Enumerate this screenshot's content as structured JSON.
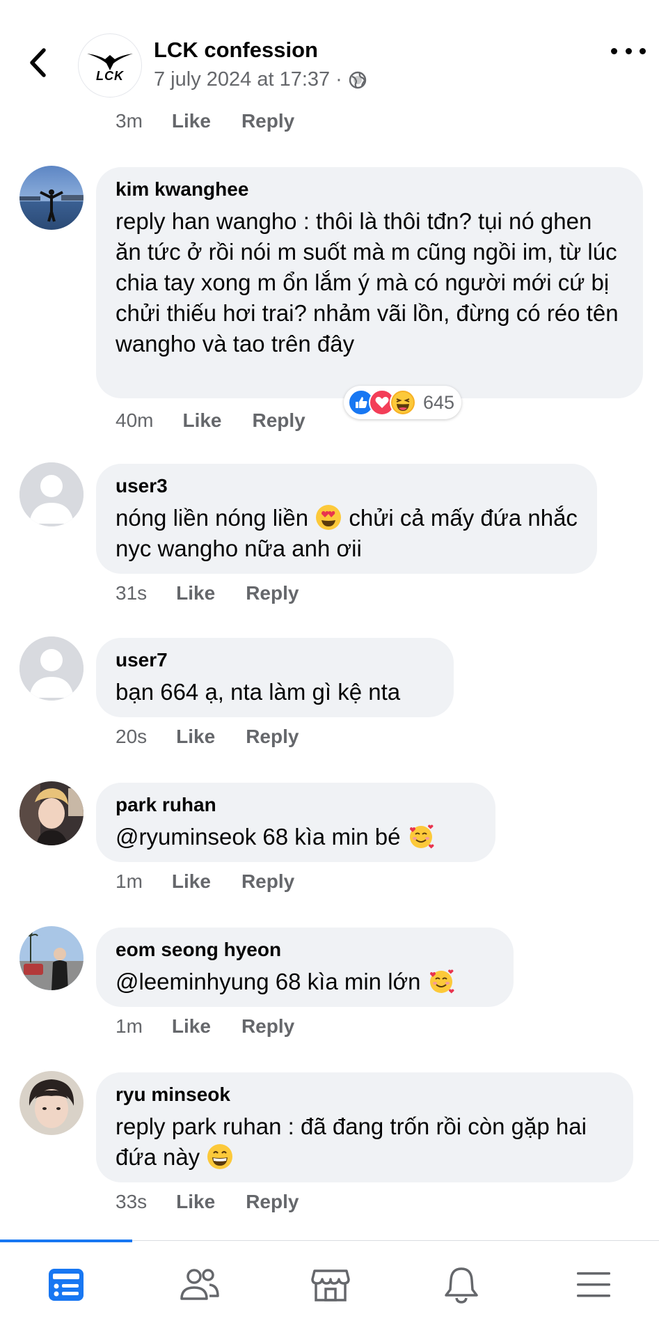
{
  "header": {
    "page_name": "LCK confession",
    "post_time": "7 july 2024 at 17:37",
    "separator": "·",
    "logo_text": "LCK"
  },
  "top_actions": {
    "time": "3m",
    "like": "Like",
    "reply": "Reply"
  },
  "comments": [
    {
      "author": "kim kwanghee",
      "text": "reply han wangho : thôi là thôi tđn? tụi nó ghen ăn tức ở rồi nói m suốt mà m cũng ngồi im, từ lúc chia tay xong m ổn lắm ý mà có người mới cứ bị chửi thiếu hơi trai? nhảm vãi lồn, đừng có réo tên wangho và tao trên đây",
      "time": "40m",
      "like": "Like",
      "reply": "Reply",
      "reaction_count": "645"
    },
    {
      "author": "user3",
      "text_before_emoji": "nóng liền nóng liền ",
      "text_after_emoji": " chửi cả mấy đứa nhắc nyc wangho nữa anh ơii",
      "emoji": "heart-eyes-emoji",
      "time": "31s",
      "like": "Like",
      "reply": "Reply"
    },
    {
      "author": "user7",
      "text": "bạn 664 ạ, nta làm gì kệ nta",
      "time": "20s",
      "like": "Like",
      "reply": "Reply"
    },
    {
      "author": "park ruhan",
      "text": "@ryuminseok 68 kìa min bé ",
      "emoji": "smiling-face-with-hearts-emoji",
      "time": "1m",
      "like": "Like",
      "reply": "Reply"
    },
    {
      "author": "eom seong hyeon",
      "text": "@leeminhyung 68 kìa min lớn ",
      "emoji": "smiling-face-with-hearts-emoji",
      "time": "1m",
      "like": "Like",
      "reply": "Reply"
    },
    {
      "author": "ryu minseok",
      "text": "reply park ruhan : đã đang trốn rồi còn gặp hai đứa này ",
      "emoji": "grinning-face-emoji",
      "time": "33s",
      "like": "Like",
      "reply": "Reply"
    }
  ],
  "nav": {
    "items": [
      "feed-icon",
      "friends-icon",
      "marketplace-icon",
      "notifications-icon",
      "menu-icon"
    ],
    "active_color": "#1877f2",
    "inactive_color": "#65676b"
  },
  "colors": {
    "bubble": "#f0f2f5",
    "secondary_text": "#65676b",
    "accent": "#1877f2"
  }
}
